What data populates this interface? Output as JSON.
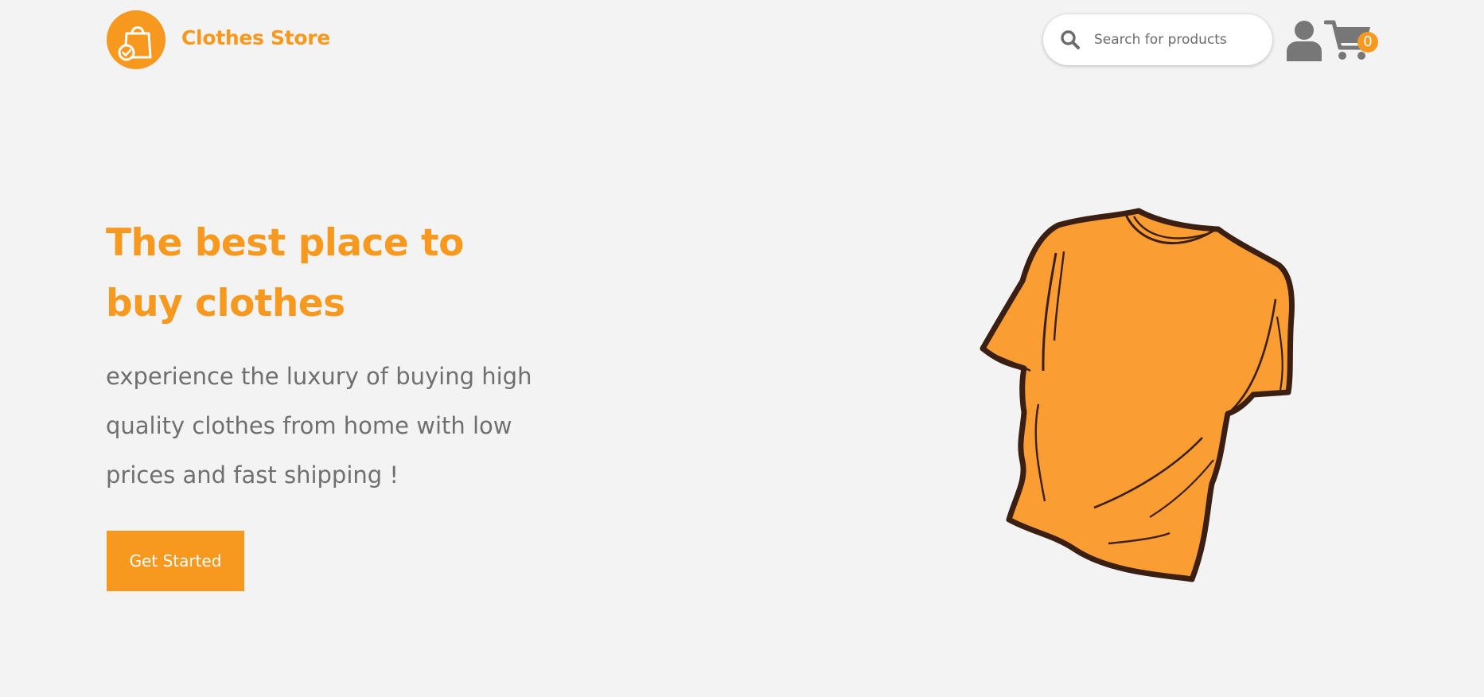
{
  "header": {
    "brand_name": "Clothes Store",
    "logo_icon": "shopping-bag-check-icon",
    "search": {
      "placeholder": "Search for products",
      "icon": "search-icon"
    },
    "user_icon": "user-icon",
    "cart": {
      "icon": "cart-icon",
      "count": "0"
    }
  },
  "hero": {
    "title_line1": "The best place to",
    "title_line2": "buy clothes",
    "subtitle_line1": "experience the luxury of buying high",
    "subtitle_line2": "quality clothes from home with low",
    "subtitle_line3": "prices and fast shipping !",
    "cta_label": "Get Started",
    "illustration": "tshirt-illustration"
  },
  "colors": {
    "accent": "#f7981f",
    "background": "#f3f3f3",
    "text_muted": "#6f6f6f",
    "icon_gray": "#777777"
  }
}
